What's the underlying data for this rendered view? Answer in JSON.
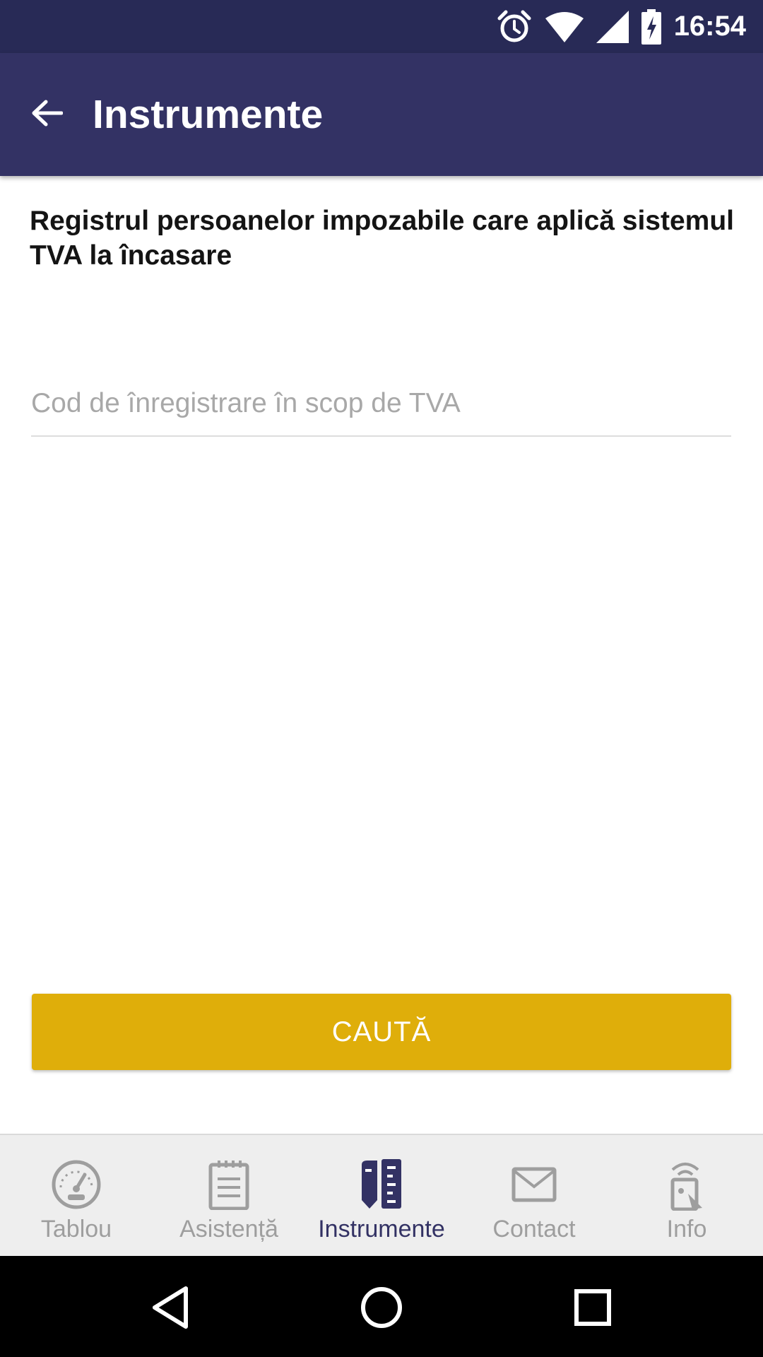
{
  "status_bar": {
    "time": "16:54",
    "icons": [
      "alarm-icon",
      "wifi-icon",
      "signal-icon",
      "battery-charging-icon"
    ],
    "background": "#282a56"
  },
  "app_bar": {
    "title": "Instrumente",
    "back_icon": "arrow-left-icon",
    "background": "#333264"
  },
  "content": {
    "heading": "Registrul persoanelor impozabile care aplică sistemul TVA la încasare",
    "vat_code_field": {
      "value": "",
      "placeholder": "Cod de înregistrare în scop de TVA"
    },
    "search_button_label": "CAUTĂ",
    "accent_color": "#dfae0a"
  },
  "bottom_nav": {
    "items": [
      {
        "label": "Tablou",
        "icon": "dashboard-gauge-icon",
        "active": false
      },
      {
        "label": "Asistență",
        "icon": "notepad-icon",
        "active": false
      },
      {
        "label": "Instrumente",
        "icon": "tools-rulers-icon",
        "active": true
      },
      {
        "label": "Contact",
        "icon": "envelope-icon",
        "active": false
      },
      {
        "label": "Info",
        "icon": "info-signal-icon",
        "active": false
      }
    ],
    "active_color": "#333264",
    "inactive_color": "#9e9e9e"
  },
  "system_nav": {
    "buttons": [
      "back-triangle-icon",
      "home-circle-icon",
      "recents-square-icon"
    ]
  }
}
